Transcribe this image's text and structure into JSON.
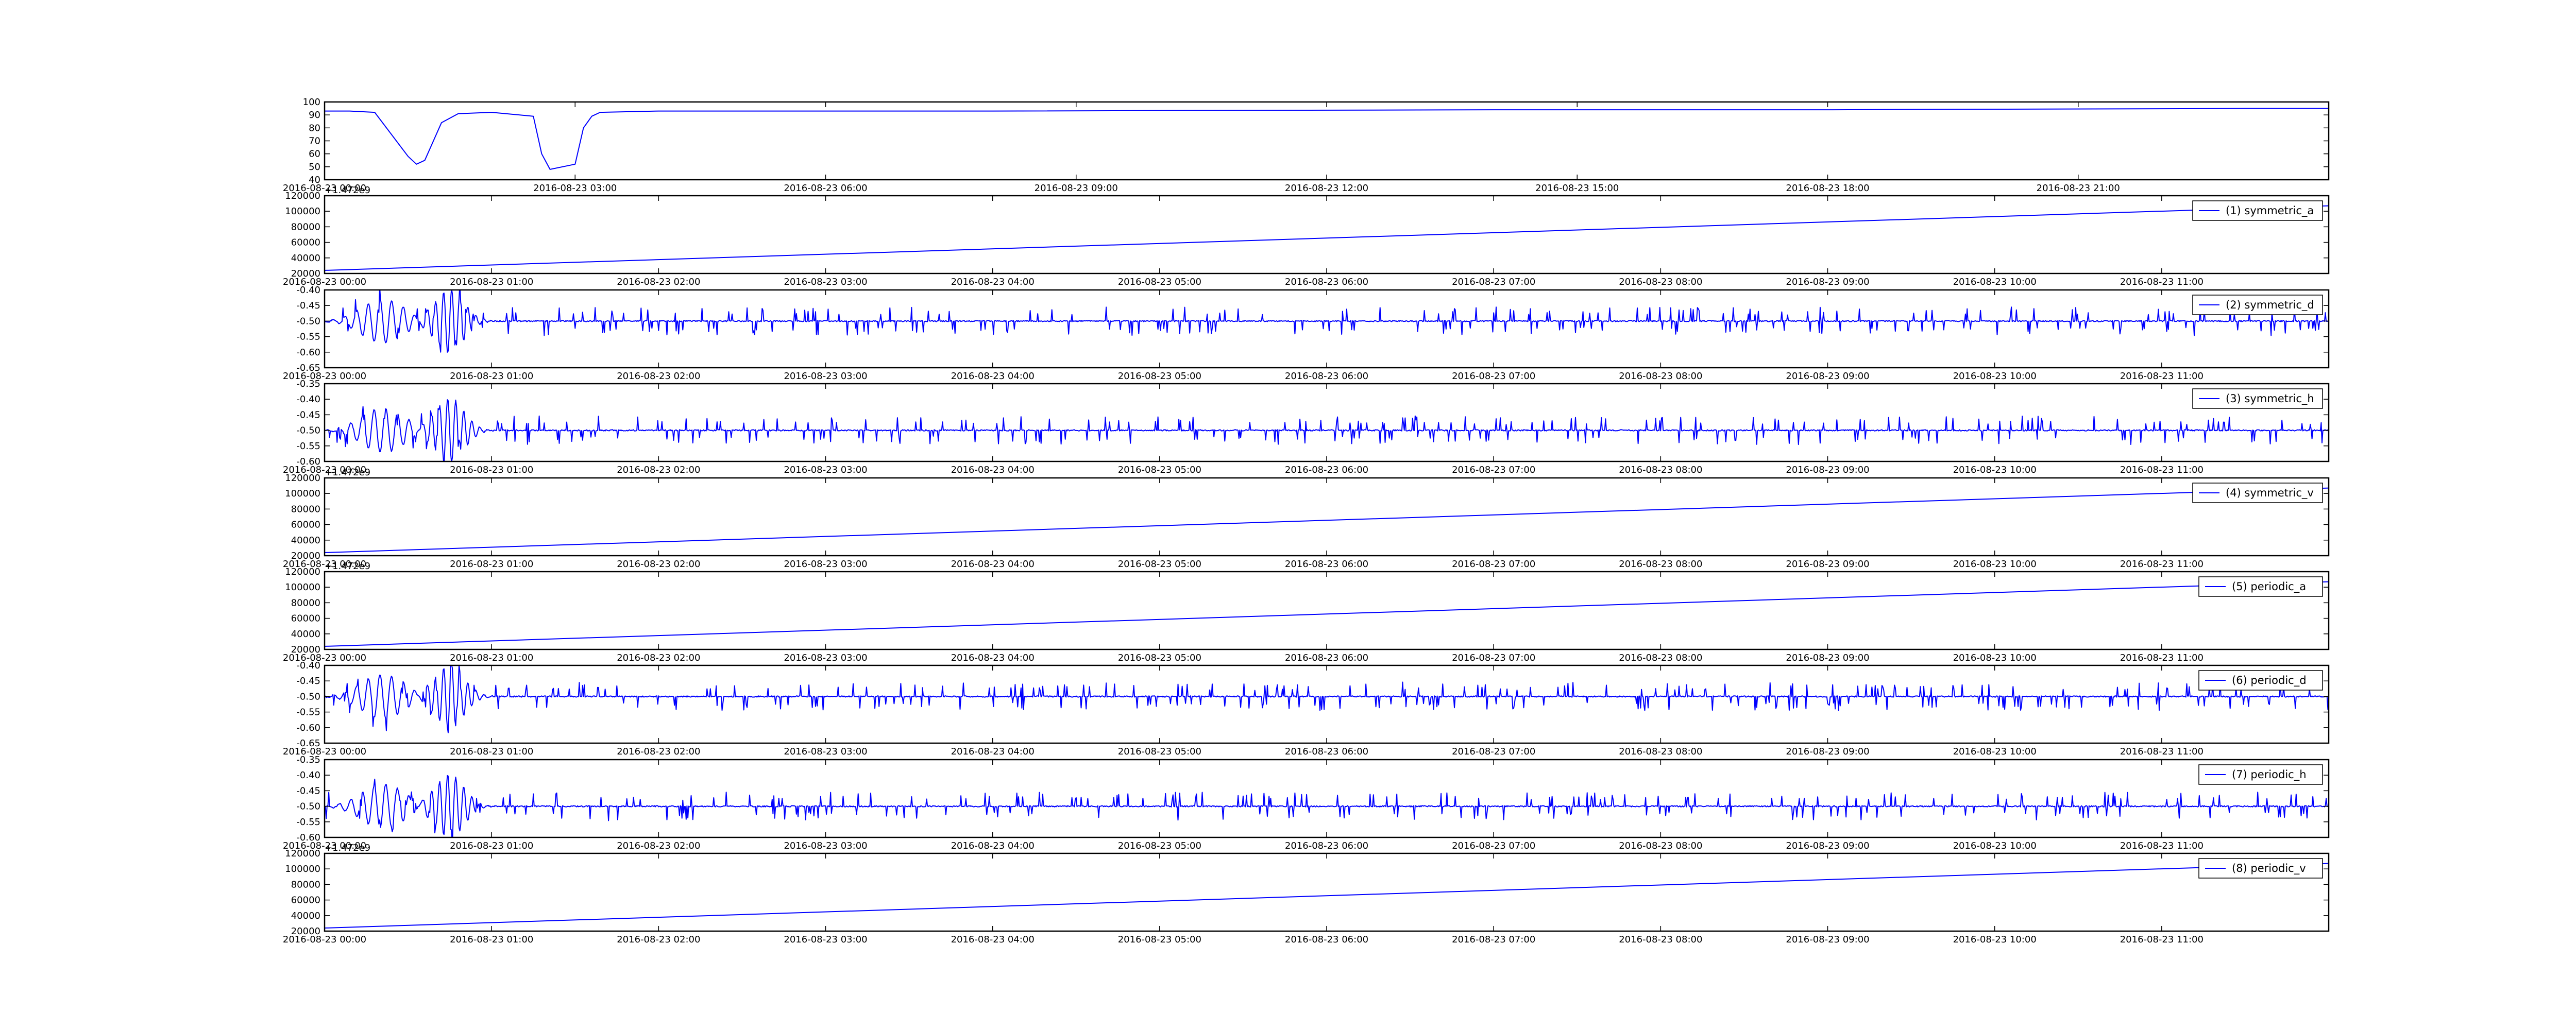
{
  "colors": {
    "series": "#0000ff",
    "axes": "#000000",
    "background": "#ffffff"
  },
  "chart_data": [
    {
      "type": "line",
      "legend": null,
      "ylim": [
        40,
        100
      ],
      "yticks": [
        "40",
        "50",
        "60",
        "70",
        "80",
        "90",
        "100"
      ],
      "xticks": [
        "2016-08-23 00:00",
        "2016-08-23 03:00",
        "2016-08-23 06:00",
        "2016-08-23 09:00",
        "2016-08-23 12:00",
        "2016-08-23 15:00",
        "2016-08-23 18:00",
        "2016-08-23 21:00"
      ],
      "xrange_hours": [
        0,
        24
      ],
      "series": [
        {
          "x_hours": [
            0,
            0.3,
            0.6,
            1.0,
            1.1,
            1.2,
            1.4,
            1.6,
            2.0,
            2.5,
            2.6,
            2.7,
            3.0,
            3.1,
            3.2,
            3.3,
            4.0,
            8.0,
            14.0,
            18.0,
            23.0,
            24.0
          ],
          "values": [
            93,
            93,
            92,
            58,
            52,
            55,
            84,
            91,
            92,
            89,
            60,
            48,
            52,
            80,
            89,
            92,
            93,
            93,
            94,
            94,
            95,
            95
          ]
        }
      ]
    },
    {
      "type": "line",
      "legend": "(1) symmetric_a",
      "offset": "+1.472e9",
      "ylim": [
        20000,
        120000
      ],
      "yticks": [
        "20000",
        "40000",
        "60000",
        "80000",
        "100000",
        "120000"
      ],
      "xticks": [
        "2016-08-23 00:00",
        "2016-08-23 01:00",
        "2016-08-23 02:00",
        "2016-08-23 03:00",
        "2016-08-23 04:00",
        "2016-08-23 05:00",
        "2016-08-23 06:00",
        "2016-08-23 07:00",
        "2016-08-23 08:00",
        "2016-08-23 09:00",
        "2016-08-23 10:00",
        "2016-08-23 11:00"
      ],
      "xrange_hours": [
        0,
        12
      ],
      "series": [
        {
          "x_hours": [
            0,
            12
          ],
          "values": [
            24000,
            107000
          ]
        }
      ]
    },
    {
      "type": "line",
      "legend": "(2) symmetric_d",
      "ylim": [
        -0.65,
        -0.4
      ],
      "yticks": [
        "-0.65",
        "-0.60",
        "-0.55",
        "-0.50",
        "-0.45",
        "-0.40"
      ],
      "xticks": [
        "2016-08-23 00:00",
        "2016-08-23 01:00",
        "2016-08-23 02:00",
        "2016-08-23 03:00",
        "2016-08-23 04:00",
        "2016-08-23 05:00",
        "2016-08-23 06:00",
        "2016-08-23 07:00",
        "2016-08-23 08:00",
        "2016-08-23 09:00",
        "2016-08-23 10:00",
        "2016-08-23 11:00"
      ],
      "xrange_hours": [
        0,
        12
      ],
      "series": [
        {
          "baseline": -0.5,
          "pattern": "spiky",
          "burst_amplitude": -0.1
        }
      ]
    },
    {
      "type": "line",
      "legend": "(3) symmetric_h",
      "ylim": [
        -0.6,
        -0.35
      ],
      "yticks": [
        "-0.60",
        "-0.55",
        "-0.50",
        "-0.45",
        "-0.40",
        "-0.35"
      ],
      "xticks": [
        "2016-08-23 00:00",
        "2016-08-23 01:00",
        "2016-08-23 02:00",
        "2016-08-23 03:00",
        "2016-08-23 04:00",
        "2016-08-23 05:00",
        "2016-08-23 06:00",
        "2016-08-23 07:00",
        "2016-08-23 08:00",
        "2016-08-23 09:00",
        "2016-08-23 10:00",
        "2016-08-23 11:00"
      ],
      "xrange_hours": [
        0,
        12
      ],
      "series": [
        {
          "baseline": -0.5,
          "pattern": "spiky",
          "burst_amplitude": 0.1
        }
      ]
    },
    {
      "type": "line",
      "legend": "(4) symmetric_v",
      "offset": "+1.472e9",
      "ylim": [
        20000,
        120000
      ],
      "yticks": [
        "20000",
        "40000",
        "60000",
        "80000",
        "100000",
        "120000"
      ],
      "xticks": [
        "2016-08-23 00:00",
        "2016-08-23 01:00",
        "2016-08-23 02:00",
        "2016-08-23 03:00",
        "2016-08-23 04:00",
        "2016-08-23 05:00",
        "2016-08-23 06:00",
        "2016-08-23 07:00",
        "2016-08-23 08:00",
        "2016-08-23 09:00",
        "2016-08-23 10:00",
        "2016-08-23 11:00"
      ],
      "xrange_hours": [
        0,
        12
      ],
      "series": [
        {
          "x_hours": [
            0,
            12
          ],
          "values": [
            24000,
            107000
          ]
        }
      ]
    },
    {
      "type": "line",
      "legend": "(5) periodic_a",
      "offset": "+1.472e9",
      "ylim": [
        20000,
        120000
      ],
      "yticks": [
        "20000",
        "40000",
        "60000",
        "80000",
        "100000",
        "120000"
      ],
      "xticks": [
        "2016-08-23 00:00",
        "2016-08-23 01:00",
        "2016-08-23 02:00",
        "2016-08-23 03:00",
        "2016-08-23 04:00",
        "2016-08-23 05:00",
        "2016-08-23 06:00",
        "2016-08-23 07:00",
        "2016-08-23 08:00",
        "2016-08-23 09:00",
        "2016-08-23 10:00",
        "2016-08-23 11:00"
      ],
      "xrange_hours": [
        0,
        12
      ],
      "series": [
        {
          "x_hours": [
            0,
            12
          ],
          "values": [
            24000,
            107000
          ]
        }
      ]
    },
    {
      "type": "line",
      "legend": "(6) periodic_d",
      "ylim": [
        -0.65,
        -0.4
      ],
      "yticks": [
        "-0.65",
        "-0.60",
        "-0.55",
        "-0.50",
        "-0.45",
        "-0.40"
      ],
      "xticks": [
        "2016-08-23 00:00",
        "2016-08-23 01:00",
        "2016-08-23 02:00",
        "2016-08-23 03:00",
        "2016-08-23 04:00",
        "2016-08-23 05:00",
        "2016-08-23 06:00",
        "2016-08-23 07:00",
        "2016-08-23 08:00",
        "2016-08-23 09:00",
        "2016-08-23 10:00",
        "2016-08-23 11:00"
      ],
      "xrange_hours": [
        0,
        12
      ],
      "series": [
        {
          "baseline": -0.5,
          "pattern": "spiky",
          "burst_amplitude": -0.1
        }
      ]
    },
    {
      "type": "line",
      "legend": "(7) periodic_h",
      "ylim": [
        -0.6,
        -0.35
      ],
      "yticks": [
        "-0.60",
        "-0.55",
        "-0.50",
        "-0.45",
        "-0.40",
        "-0.35"
      ],
      "xticks": [
        "2016-08-23 00:00",
        "2016-08-23 01:00",
        "2016-08-23 02:00",
        "2016-08-23 03:00",
        "2016-08-23 04:00",
        "2016-08-23 05:00",
        "2016-08-23 06:00",
        "2016-08-23 07:00",
        "2016-08-23 08:00",
        "2016-08-23 09:00",
        "2016-08-23 10:00",
        "2016-08-23 11:00"
      ],
      "xrange_hours": [
        0,
        12
      ],
      "series": [
        {
          "baseline": -0.5,
          "pattern": "spiky",
          "burst_amplitude": 0.1
        }
      ]
    },
    {
      "type": "line",
      "legend": "(8) periodic_v",
      "offset": "+1.472e9",
      "ylim": [
        20000,
        120000
      ],
      "yticks": [
        "20000",
        "40000",
        "60000",
        "80000",
        "100000",
        "120000"
      ],
      "xticks": [
        "2016-08-23 00:00",
        "2016-08-23 01:00",
        "2016-08-23 02:00",
        "2016-08-23 03:00",
        "2016-08-23 04:00",
        "2016-08-23 05:00",
        "2016-08-23 06:00",
        "2016-08-23 07:00",
        "2016-08-23 08:00",
        "2016-08-23 09:00",
        "2016-08-23 10:00",
        "2016-08-23 11:00"
      ],
      "xrange_hours": [
        0,
        12
      ],
      "series": [
        {
          "x_hours": [
            0,
            12
          ],
          "values": [
            24000,
            107000
          ]
        }
      ]
    }
  ]
}
